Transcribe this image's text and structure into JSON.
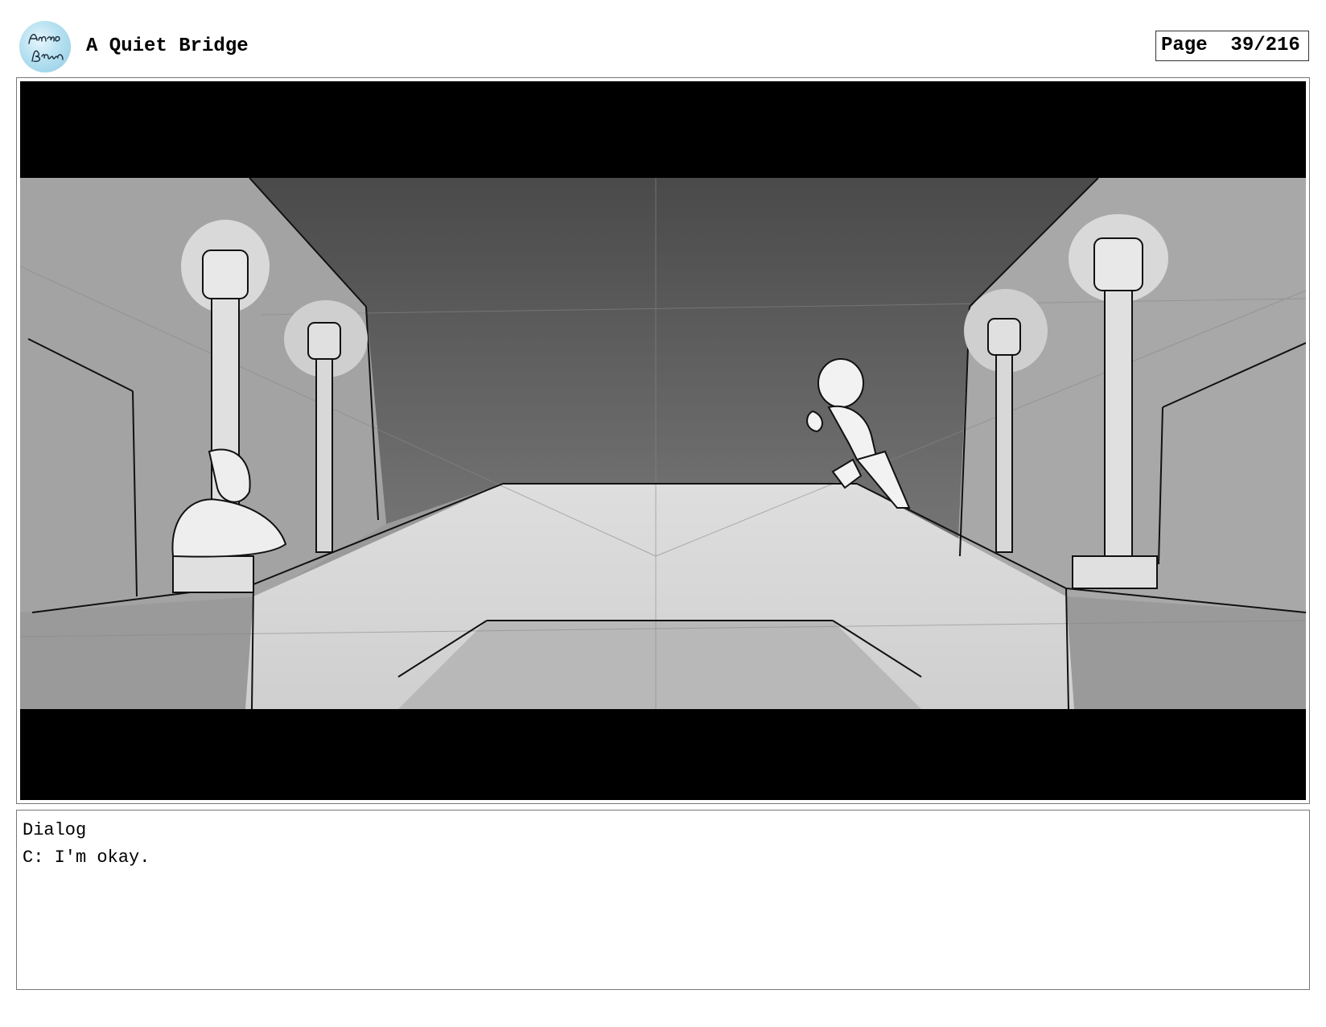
{
  "header": {
    "logo_icon": "artist-signature-logo",
    "title": "A Quiet Bridge",
    "page_label": "Page",
    "page_number": "39/216"
  },
  "panel": {
    "image_icon": "storyboard-sketch-bridge-scene"
  },
  "dialog": {
    "label": "Dialog",
    "line": "C: I'm okay."
  }
}
